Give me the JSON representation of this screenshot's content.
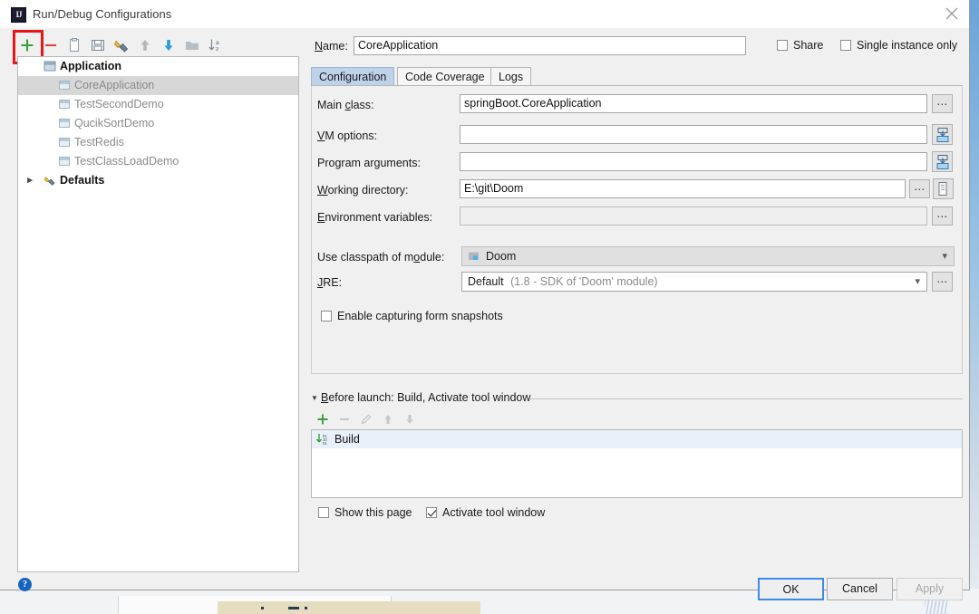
{
  "window": {
    "title": "Run/Debug Configurations",
    "app_icon": "intellij-idea-icon",
    "close_icon": "close-icon"
  },
  "left_toolbar": {
    "buttons": [
      {
        "name": "add-configuration-button",
        "icon": "plus-icon",
        "tooltip": "Add New Configuration"
      },
      {
        "name": "remove-configuration-button",
        "icon": "minus-icon",
        "tooltip": "Remove Configuration"
      },
      {
        "name": "copy-configuration-button",
        "icon": "copy-icon",
        "tooltip": "Copy Configuration"
      },
      {
        "name": "save-configuration-button",
        "icon": "save-icon",
        "tooltip": "Save Configuration"
      },
      {
        "name": "edit-templates-button",
        "icon": "wrench-icon",
        "tooltip": "Edit Templates"
      },
      {
        "name": "move-up-button",
        "icon": "arrow-up-icon",
        "tooltip": "Move Up"
      },
      {
        "name": "move-down-button",
        "icon": "arrow-down-icon",
        "tooltip": "Move Down"
      },
      {
        "name": "new-folder-button",
        "icon": "folder-icon",
        "tooltip": "Create New Folder"
      },
      {
        "name": "sort-configurations-button",
        "icon": "sort-az-icon",
        "tooltip": "Sort Configurations"
      }
    ]
  },
  "annotation": {
    "color": "#e8161a",
    "target": "add-configuration-button"
  },
  "tree": {
    "nodes": [
      {
        "label": "Application",
        "type": "group",
        "icon": "application-icon",
        "selected": false,
        "expanded": true
      },
      {
        "label": "CoreApplication",
        "type": "leaf",
        "icon": "run-config-icon",
        "selected": true
      },
      {
        "label": "TestSecondDemo",
        "type": "leaf",
        "icon": "run-config-icon",
        "selected": false
      },
      {
        "label": "QucikSortDemo",
        "type": "leaf",
        "icon": "run-config-icon",
        "selected": false
      },
      {
        "label": "TestRedis",
        "type": "leaf",
        "icon": "run-config-icon",
        "selected": false
      },
      {
        "label": "TestClassLoadDemo",
        "type": "leaf",
        "icon": "run-config-icon",
        "selected": false
      },
      {
        "label": "Defaults",
        "type": "group",
        "icon": "wrench-icon",
        "selected": false,
        "expanded": false
      }
    ]
  },
  "header": {
    "name_label": "Name:",
    "name_value": "CoreApplication",
    "share_label": "Share",
    "share_checked": false,
    "single_instance_label": "Single instance only",
    "single_instance_checked": false
  },
  "tabs": [
    {
      "label": "Configuration",
      "active": true
    },
    {
      "label": "Code Coverage",
      "active": false
    },
    {
      "label": "Logs",
      "active": false
    }
  ],
  "configuration": {
    "main_class": {
      "label": "Main class:",
      "value": "springBoot.CoreApplication",
      "browse_icon": "ellipsis-icon"
    },
    "vm_options": {
      "label": "VM options:",
      "value": "",
      "expand_icon": "expand-editor-icon"
    },
    "program_arguments": {
      "label": "Program arguments:",
      "value": "",
      "expand_icon": "expand-editor-icon"
    },
    "working_directory": {
      "label": "Working directory:",
      "value": "E:\\git\\Doom",
      "browse_icon": "ellipsis-icon",
      "macro_icon": "insert-macro-icon"
    },
    "environment_variables": {
      "label": "Environment variables:",
      "value": "",
      "browse_icon": "ellipsis-icon"
    },
    "use_classpath_of_module": {
      "label": "Use classpath of module:",
      "value": "Doom",
      "icon": "module-icon",
      "caret_icon": "chevron-down-icon"
    },
    "jre": {
      "label": "JRE:",
      "value": "Default",
      "value_detail": "(1.8 - SDK of 'Doom' module)",
      "caret_icon": "chevron-down-icon",
      "browse_icon": "ellipsis-icon"
    },
    "enable_form_snapshots": {
      "label": "Enable capturing form snapshots",
      "checked": false
    }
  },
  "before_launch": {
    "title": "Before launch: Build, Activate tool window",
    "collapse_icon": "triangle-down-icon",
    "toolbar": [
      {
        "name": "before-launch-add-button",
        "icon": "plus-icon",
        "enabled": true
      },
      {
        "name": "before-launch-remove-button",
        "icon": "minus-icon",
        "enabled": false
      },
      {
        "name": "before-launch-edit-button",
        "icon": "pencil-icon",
        "enabled": false
      },
      {
        "name": "before-launch-up-button",
        "icon": "arrow-up-icon",
        "enabled": false
      },
      {
        "name": "before-launch-down-button",
        "icon": "arrow-down-icon",
        "enabled": false
      }
    ],
    "items": [
      {
        "label": "Build",
        "icon": "build-icon",
        "selected": true
      }
    ],
    "show_this_page": {
      "label": "Show this page",
      "checked": false
    },
    "activate_tool_window": {
      "label": "Activate tool window",
      "checked": true
    }
  },
  "footer": {
    "help_icon": "help-icon",
    "buttons": [
      {
        "label": "OK",
        "name": "ok-button",
        "style": "default"
      },
      {
        "label": "Cancel",
        "name": "cancel-button",
        "style": "normal"
      },
      {
        "label": "Apply",
        "name": "apply-button",
        "style": "disabled"
      }
    ]
  },
  "colors": {
    "accent_blue": "#3b8beb",
    "selected_tab": "#bed2ea",
    "tree_selection": "#d7d7d7",
    "list_selection": "#e8f0f9",
    "annotation_red": "#e8161a",
    "add_green": "#3aa03a",
    "remove_red": "#d94a3d"
  }
}
